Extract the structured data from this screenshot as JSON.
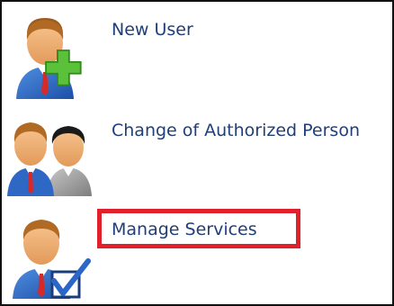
{
  "menu": {
    "items": [
      {
        "label": "New User",
        "icon": "user-add-icon"
      },
      {
        "label": "Change of Authorized Person",
        "icon": "users-change-icon"
      },
      {
        "label": "Manage Services",
        "icon": "user-check-icon"
      }
    ]
  },
  "highlight": {
    "target": "Manage Services",
    "color": "#e0202a"
  },
  "colors": {
    "link_text": "#1f3f7a",
    "plus": "#5cc13a",
    "check": "#2a67c8"
  }
}
